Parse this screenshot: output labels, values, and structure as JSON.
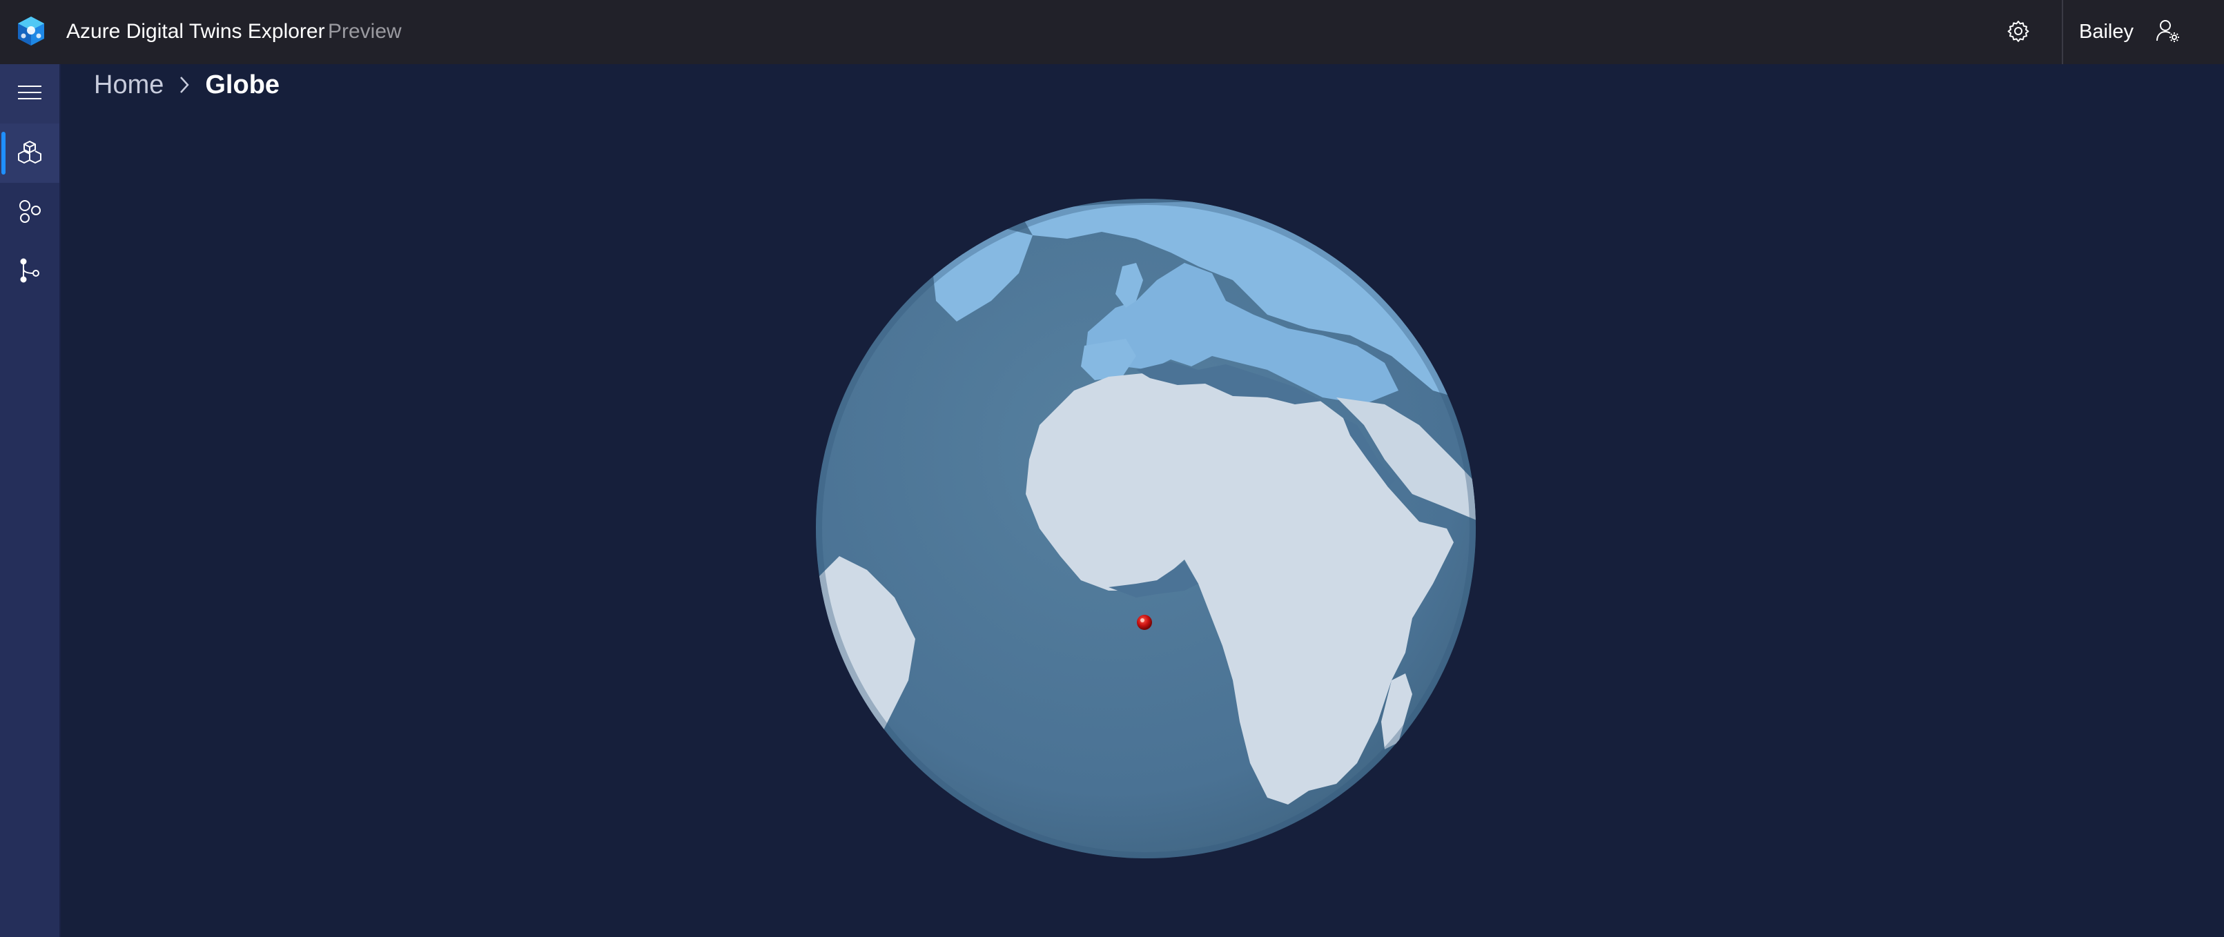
{
  "header": {
    "app_name": "Azure Digital Twins Explorer",
    "app_tag": "Preview",
    "user_name": "Bailey",
    "icons": {
      "logo": "azure-digital-twins-logo-icon",
      "settings": "gear-icon",
      "account": "user-settings-icon"
    }
  },
  "nav": {
    "items": [
      {
        "name": "menu",
        "icon": "hamburger-icon",
        "active": false
      },
      {
        "name": "twins",
        "icon": "cube-cluster-icon",
        "active": true
      },
      {
        "name": "models",
        "icon": "model-nodes-icon",
        "active": false
      },
      {
        "name": "graph",
        "icon": "branch-graph-icon",
        "active": false
      }
    ]
  },
  "breadcrumb": {
    "home": "Home",
    "current": "Globe"
  },
  "globe": {
    "marker_count": 1,
    "marker_icon": "location-pin-icon"
  },
  "colors": {
    "background": "#161f3b",
    "topbar": "#212129",
    "nav": "#252f5a",
    "accent": "#1f8fff",
    "ocean": "#4b7396",
    "land": "#cfdae6",
    "europe": "#7fb3de",
    "marker": "#c81010"
  }
}
